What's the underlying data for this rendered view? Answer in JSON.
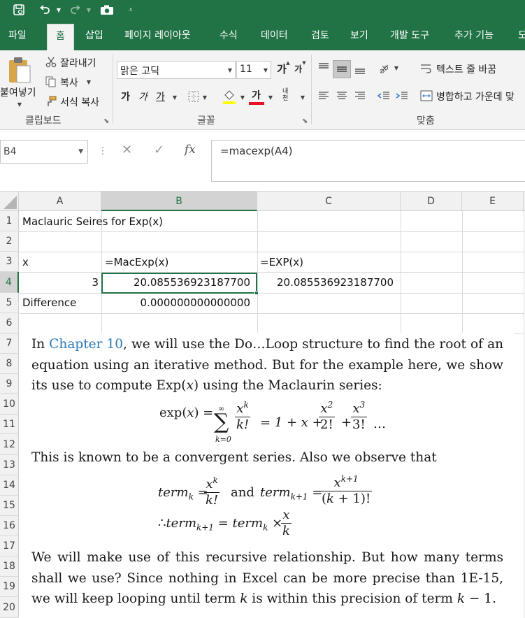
{
  "ribbon_tabs": [
    "파일",
    "홈",
    "삽입",
    "페이지 레이아웃",
    "수식",
    "데이터",
    "검토",
    "보기",
    "개발 도구",
    "추가 기능",
    "도"
  ],
  "active_tab": "홈",
  "clipboard": {
    "paste": "붙여넣기",
    "cut": "잘라내기",
    "copy": "복사",
    "format_painter": "서식 복사",
    "group_label": "클립보드"
  },
  "font": {
    "name": "맑은 고딕",
    "size": "11",
    "grow": "가",
    "shrink": "가",
    "bold": "가",
    "italic": "가",
    "underline": "가",
    "font_color_glyph": "가",
    "phonetic_glyph": "내천",
    "group_label": "글꼴"
  },
  "alignment": {
    "wrap_text": "텍스트 줄 바꿈",
    "merge_center": "병합하고 가운데 맞",
    "group_label": "맞춤"
  },
  "formula_bar": {
    "name_box": "B4",
    "cancel": "✕",
    "enter": "✓",
    "fx": "fx",
    "formula": "=macexp(A4)"
  },
  "columns": [
    "A",
    "B",
    "C",
    "D",
    "E"
  ],
  "selected_column": "B",
  "rows": [
    "1",
    "2",
    "3",
    "4",
    "5",
    "6",
    "7",
    "8",
    "9",
    "10",
    "11",
    "12",
    "13",
    "14",
    "15",
    "16",
    "17",
    "18",
    "19",
    "20"
  ],
  "selected_row": "4",
  "cells": {
    "A1": "Maclauric Seires for Exp(x)",
    "A3": "x",
    "B3": "=MacExp(x)",
    "C3": "=EXP(x)",
    "A4": "3",
    "B4": "20.085536923187700",
    "C4": "20.085536923187700",
    "A5": "Difference",
    "B5": "0.000000000000000"
  },
  "picture": {
    "p1_before": "In ",
    "p1_link": "Chapter 10",
    "p1_after": ", we will use the Do…Loop structure to find the root of an equation using an iterative method. But for the example here, we show its use to compute Exp(",
    "p1_x": "x",
    "p1_end": ") using the Maclaurin series:",
    "p2": "This is known to be a convergent series. Also we observe that",
    "p3_a": "We will make use of this recursive relationship. But how many terms shall we use? Since nothing in Excel can be more precise than 1E-15, we will keep looping until term ",
    "p3_k": "k",
    "p3_b": " is within this precision of term ",
    "p3_k2": "k",
    "p3_c": " − 1.",
    "eq1_lhs": "exp(",
    "eq1_x": "x",
    "eq1_rhs_open": ") = ",
    "eq1_sum_top": "∞",
    "eq1_sigma": "∑",
    "eq1_sum_bot": "k=0",
    "eq1_rest": "= 1 + x +",
    "eq1_tail": "+",
    "eq1_dots": "…",
    "term": "term",
    "and": "and",
    "therefore": "∴"
  }
}
